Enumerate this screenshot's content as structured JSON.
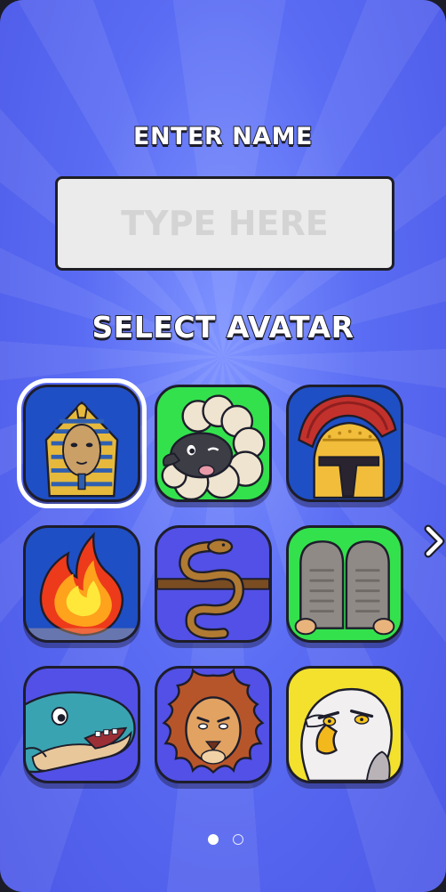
{
  "labels": {
    "enter_name": "ENTER NAME",
    "select_avatar": "SELECT AVATAR"
  },
  "name_input": {
    "value": "",
    "placeholder": "TYPE HERE"
  },
  "avatars": [
    {
      "name": "pharaoh",
      "bg": "#1f4fc4",
      "selected": true
    },
    {
      "name": "sheep",
      "bg": "#33e14c",
      "selected": false
    },
    {
      "name": "spartan-helmet",
      "bg": "#1f4fc4",
      "selected": false
    },
    {
      "name": "fire",
      "bg": "#1f4fc4",
      "selected": false
    },
    {
      "name": "snake-staff",
      "bg": "#5250e6",
      "selected": false
    },
    {
      "name": "stone-tablets",
      "bg": "#33e14c",
      "selected": false
    },
    {
      "name": "whale",
      "bg": "#5250e6",
      "selected": false
    },
    {
      "name": "lion",
      "bg": "#5250e6",
      "selected": false
    },
    {
      "name": "eagle",
      "bg": "#f3e12e",
      "selected": false
    }
  ],
  "pagination": {
    "pages": 2,
    "current_page": 1
  },
  "colors": {
    "background": "#5a6cf3",
    "input_bg": "#ebebeb",
    "outline": "#1d1d2b"
  },
  "icons": {
    "next": "chevron-right-icon"
  }
}
